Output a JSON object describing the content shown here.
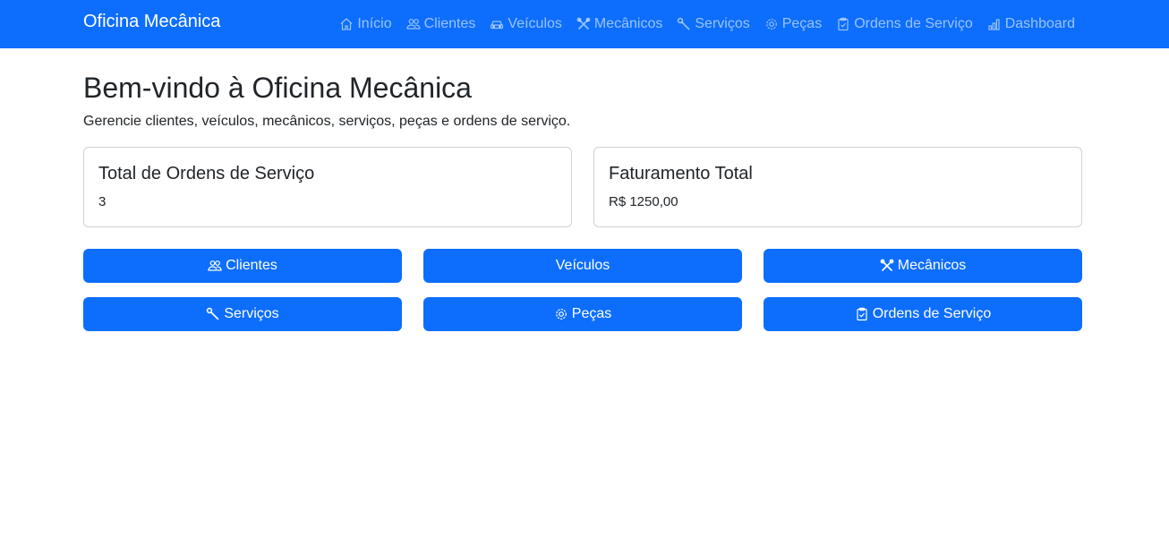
{
  "navbar": {
    "brand": "Oficina Mecânica",
    "items": [
      {
        "label": "Início",
        "icon": "house-icon"
      },
      {
        "label": "Clientes",
        "icon": "people-icon"
      },
      {
        "label": "Veículos",
        "icon": "car-icon"
      },
      {
        "label": "Mecânicos",
        "icon": "tools-icon"
      },
      {
        "label": "Serviços",
        "icon": "wrench-icon"
      },
      {
        "label": "Peças",
        "icon": "gear-icon"
      },
      {
        "label": "Ordens de Serviço",
        "icon": "clipboard-check-icon"
      },
      {
        "label": "Dashboard",
        "icon": "bar-chart-icon"
      }
    ]
  },
  "main": {
    "title": "Bem-vindo à Oficina Mecânica",
    "subtitle": "Gerencie clientes, veículos, mecânicos, serviços, peças e ordens de serviço."
  },
  "cards": [
    {
      "title": "Total de Ordens de Serviço",
      "value": "3"
    },
    {
      "title": "Faturamento Total",
      "value": "R$ 1250,00"
    }
  ],
  "buttons": [
    {
      "label": "Clientes",
      "icon": "people-icon"
    },
    {
      "label": "Veículos",
      "icon": ""
    },
    {
      "label": "Mecânicos",
      "icon": "tools-icon"
    },
    {
      "label": "Serviços",
      "icon": "wrench-icon"
    },
    {
      "label": "Peças",
      "icon": "gear-icon"
    },
    {
      "label": "Ordens de Serviço",
      "icon": "clipboard-check-icon"
    }
  ],
  "colors": {
    "primary": "#0d6efd",
    "text": "#212529",
    "nav_text": "#c6dbff"
  }
}
